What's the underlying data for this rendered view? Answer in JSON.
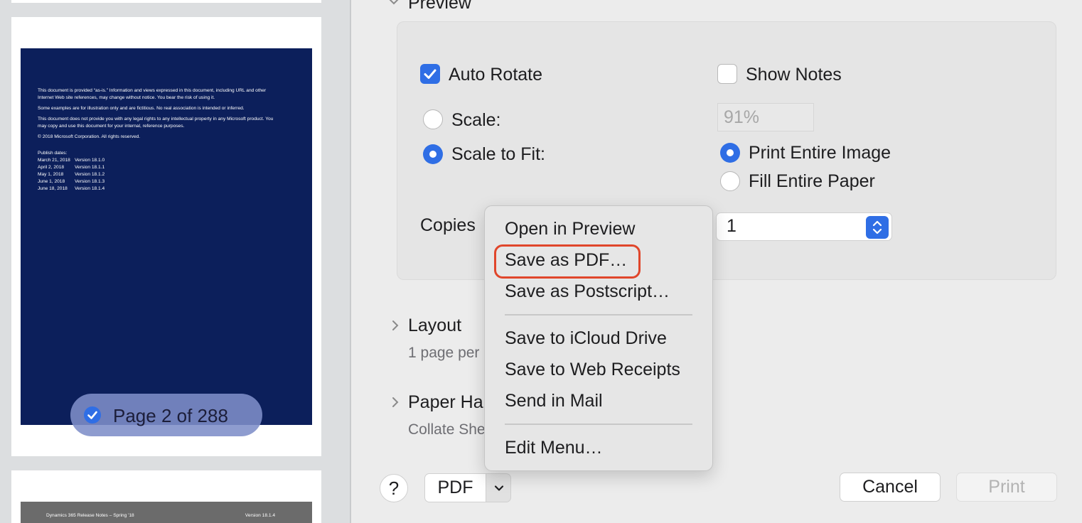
{
  "sidebar": {
    "doc_lines_1": [
      "This document is provided “as-is.” Information and views expressed in this document, including URL and other",
      "Internet Web site references, may change without notice. You bear the risk of using it."
    ],
    "doc_line_2": "Some examples are for illustration only and are fictitious. No real association is intended or inferred.",
    "doc_lines_3": [
      "This document does not provide you with any legal rights to any intellectual property in any Microsoft product. You",
      "may copy and use this document for your internal, reference purposes."
    ],
    "copyright": "© 2018 Microsoft Corporation. All rights reserved.",
    "publish_heading": "Publish dates:",
    "publish_rows": [
      {
        "date": "March 21, 2018",
        "version": "Version 18.1.0"
      },
      {
        "date": "April 2, 2018",
        "version": "Version 18.1.1"
      },
      {
        "date": "May 1, 2018",
        "version": "Version 18.1.2"
      },
      {
        "date": "June 1, 2018",
        "version": "Version 18.1.3"
      },
      {
        "date": "June 18, 2018",
        "version": "Version 18.1.4"
      }
    ],
    "page_badge": "Page 2 of 288",
    "next_page_header_left": "Dynamics 365 Release Notes – Spring '18",
    "next_page_header_right": "Version 18.1.4"
  },
  "preview_section": {
    "title": "Preview",
    "auto_rotate_label": "Auto Rotate",
    "auto_rotate_checked": true,
    "show_notes_label": "Show Notes",
    "show_notes_checked": false,
    "scale_label": "Scale:",
    "scale_value": "91%",
    "scale_to_fit_label": "Scale to Fit:",
    "fit_option_1": "Print Entire Image",
    "fit_option_2": "Fill Entire Paper",
    "copies_label": "Copies",
    "copies_value": "1"
  },
  "layout_section": {
    "title": "Layout",
    "subtitle": "1 page per"
  },
  "paper_section": {
    "title": "Paper Ha",
    "subtitle": "Collate She"
  },
  "bottom_bar": {
    "help_label": "?",
    "pdf_label": "PDF",
    "cancel_label": "Cancel",
    "print_label": "Print"
  },
  "pdf_menu": {
    "items": [
      "Open in Preview",
      "Save as PDF…",
      "Save as Postscript…",
      "Save to iCloud Drive",
      "Save to Web Receipts",
      "Send in Mail",
      "Edit Menu…"
    ],
    "highlight_color": "#e0462b"
  },
  "colors": {
    "accent": "#2f6ee5",
    "doc_background": "#0c1f5b"
  }
}
